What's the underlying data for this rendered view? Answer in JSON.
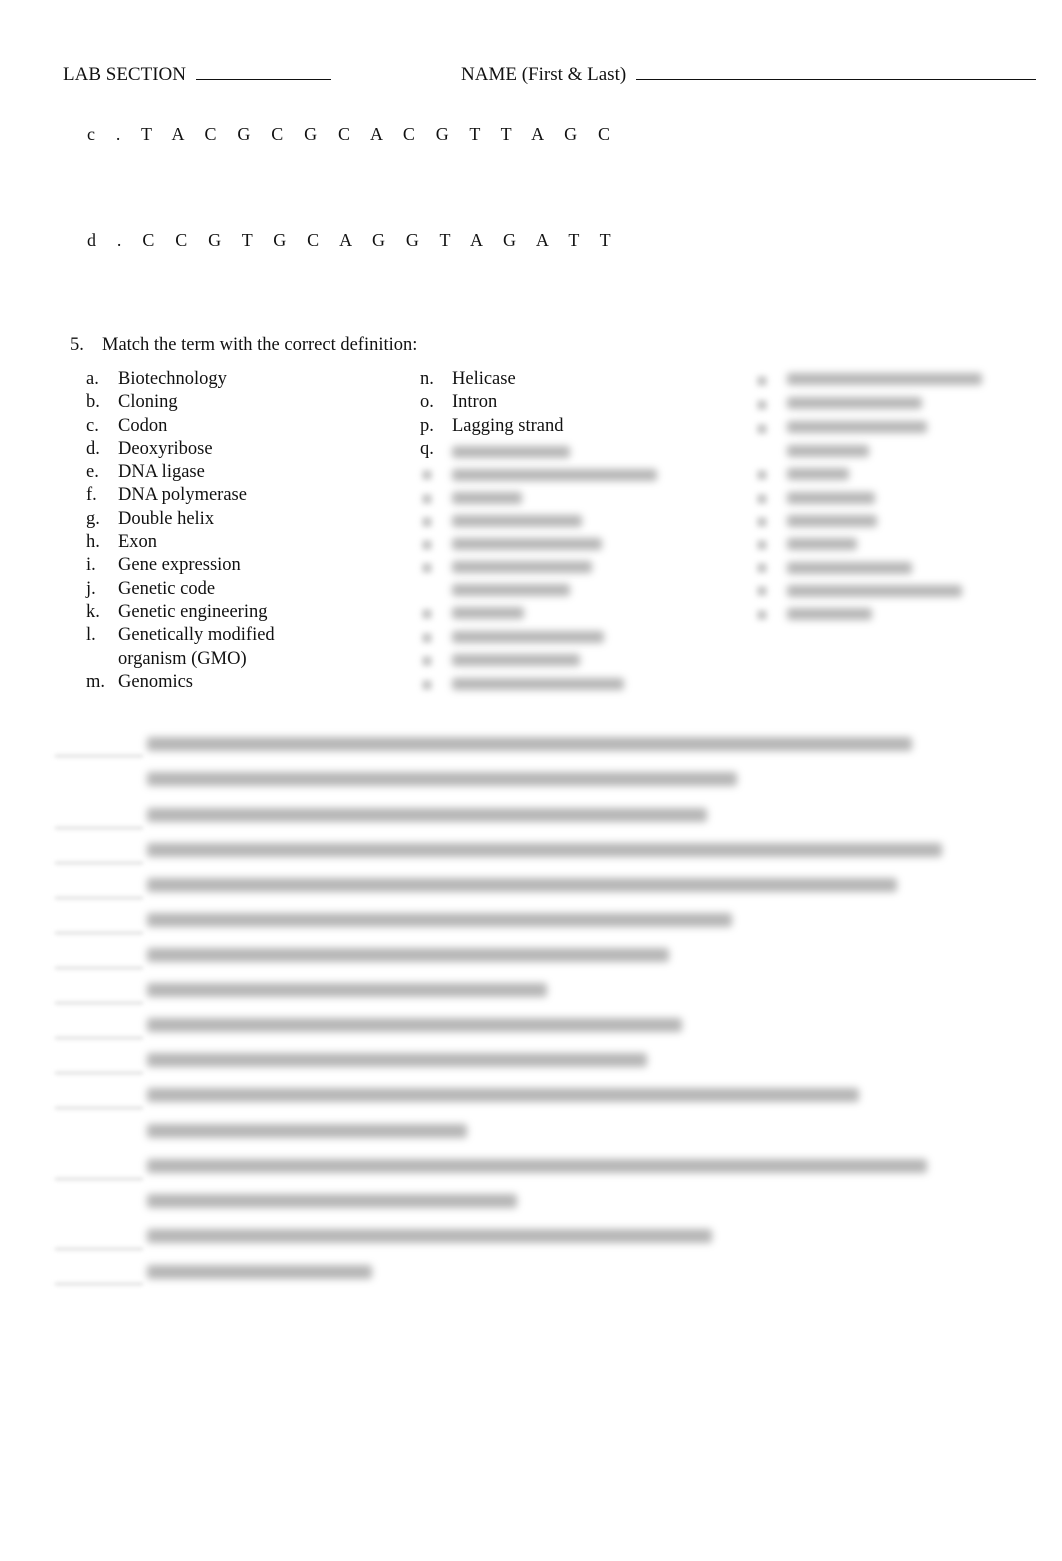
{
  "header": {
    "lab_section_label": "LAB SECTION",
    "name_label": "NAME (First & Last)"
  },
  "sequences": [
    {
      "label": "c .",
      "bases": "T A C G C G C A C G T T A G C"
    },
    {
      "label": "d .",
      "bases": "C C G T G C A G G T A G A T T"
    }
  ],
  "question": {
    "number": "5.",
    "prompt": "Match the term with the correct definition:"
  },
  "terms_col1": [
    {
      "letter": "a.",
      "term": "Biotechnology"
    },
    {
      "letter": "b.",
      "term": "Cloning"
    },
    {
      "letter": "c.",
      "term": "Codon"
    },
    {
      "letter": "d.",
      "term": "Deoxyribose"
    },
    {
      "letter": "e.",
      "term": "DNA ligase"
    },
    {
      "letter": "f.",
      "term": "DNA polymerase"
    },
    {
      "letter": "g.",
      "term": "Double helix"
    },
    {
      "letter": "h.",
      "term": "Exon"
    },
    {
      "letter": "i.",
      "term": "Gene expression"
    },
    {
      "letter": "j.",
      "term": "Genetic code"
    },
    {
      "letter": "k.",
      "term": "Genetic engineering"
    },
    {
      "letter": "l.",
      "term": "Genetically modified organism (GMO)"
    },
    {
      "letter": "m.",
      "term": "Genomics"
    }
  ],
  "terms_col2": [
    {
      "letter": "n.",
      "term": "Helicase"
    },
    {
      "letter": "o.",
      "term": "Intron"
    },
    {
      "letter": "p.",
      "term": "Lagging strand"
    },
    {
      "letter": "q.",
      "term": ""
    }
  ],
  "blurred_notice": "Remaining terms and definitions are obscured (blurred) in the screenshot"
}
